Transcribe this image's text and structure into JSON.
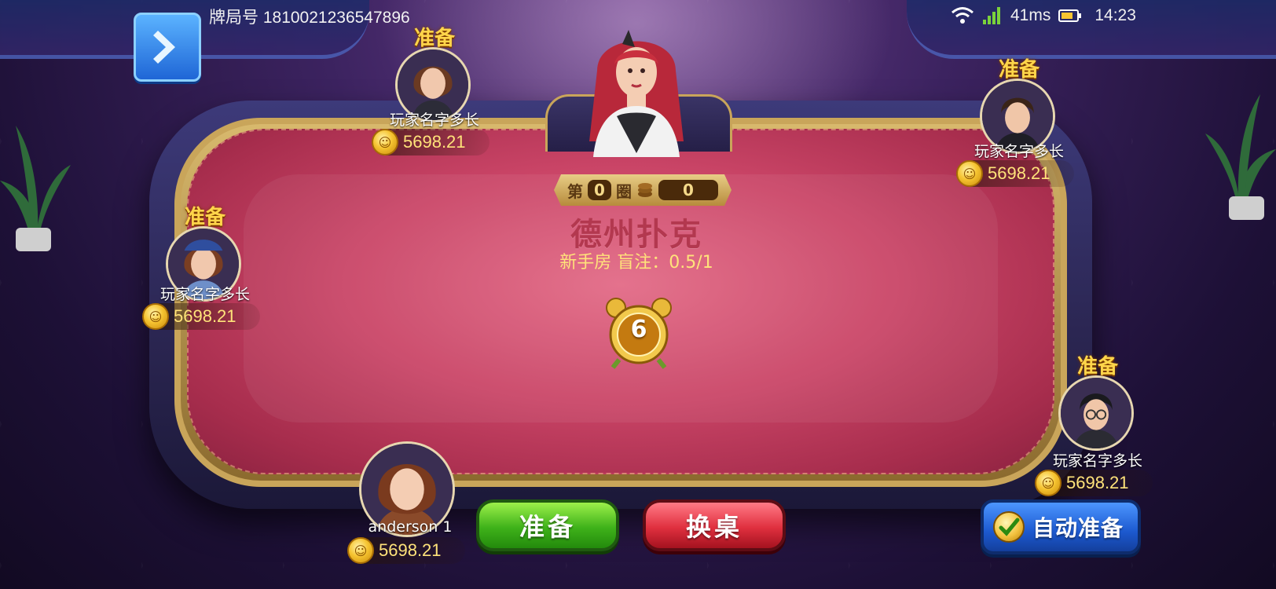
{
  "header": {
    "round_id_label": "牌局号 1810021236547896",
    "ping": "41ms",
    "time": "14:23"
  },
  "table": {
    "round_label": "第",
    "round_value": "0",
    "circle_label": "圈",
    "pot_value": "0",
    "game_title": "德州扑克",
    "room_info": "新手房 盲注：0.5/1",
    "countdown": "6"
  },
  "players": [
    {
      "ready": "准备",
      "name": "玩家名字多长",
      "chips": "5698.21"
    },
    {
      "ready": "准备",
      "name": "玩家名字多长",
      "chips": "5698.21"
    },
    {
      "ready": "准备",
      "name": "玩家名字多长",
      "chips": "5698.21"
    },
    {
      "ready": "准备",
      "name": "玩家名字多长",
      "chips": "5698.21"
    }
  ],
  "self_player": {
    "name": "anderson 1",
    "chips": "5698.21"
  },
  "buttons": {
    "ready": "准备",
    "change_table": "换桌",
    "auto_ready": "自动准备"
  },
  "colors": {
    "felt": "#c94466",
    "rim_gold": "#c9a55a",
    "ready_text": "#ffd54a",
    "chip_text": "#ffe37a"
  },
  "icons": {
    "back": "chevron-right-icon",
    "wifi": "wifi-icon",
    "signal": "signal-icon",
    "battery": "battery-icon",
    "coin": "coin-icon",
    "alarm": "alarm-clock-icon",
    "check": "check-icon"
  }
}
